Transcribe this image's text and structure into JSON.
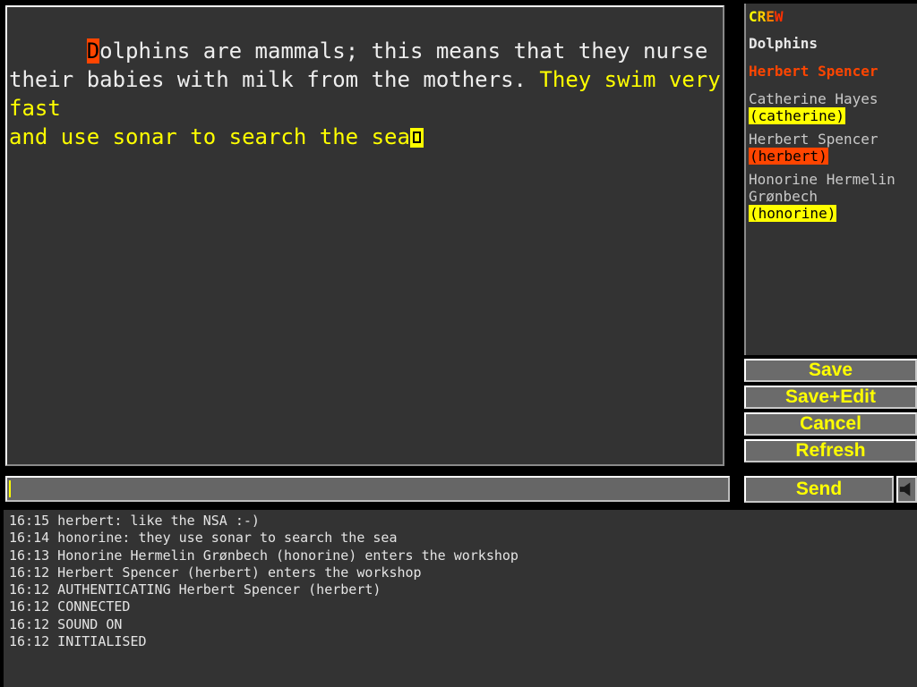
{
  "editor": {
    "segments": [
      {
        "kind": "cursor-char",
        "text": "D"
      },
      {
        "kind": "white",
        "text": "olphins are mammals; this means that they nurse their babies with milk from the "
      },
      {
        "kind": "yellow",
        "text": "They swim very fast\nand use sonar to search the sea"
      },
      {
        "kind": "block-cursor",
        "text": ""
      }
    ],
    "full_text": "Dolphins are mammals; this means that they nurse their babies with milk from the mothers. They swim very fast\nand use sonar to search the sea",
    "line1_white": "olphins are mammals; this means that they nurse their babies with milk from the mothers. ",
    "line1_cursor_char": "D",
    "yellow_run": "They swim very fast",
    "line2_yellow": "and use sonar to search the sea"
  },
  "message_input": {
    "value": "",
    "placeholder": ""
  },
  "crew": {
    "title_letters": [
      "C",
      "R",
      "E",
      "W"
    ],
    "title": "CREW",
    "room": "Dolphins",
    "self_user": "Herbert Spencer",
    "members": [
      {
        "name": "Catherine Hayes",
        "handle": "(catherine)",
        "highlight": "yellow"
      },
      {
        "name": "Herbert Spencer",
        "handle": "(herbert)",
        "highlight": "orange"
      },
      {
        "name": "Honorine Hermelin Grønbech",
        "handle": "(honorine)",
        "highlight": "yellow"
      }
    ]
  },
  "buttons": {
    "save": "Save",
    "save_edit": "Save+Edit",
    "cancel": "Cancel",
    "refresh": "Refresh",
    "send": "Send",
    "sound_icon": "speaker-icon"
  },
  "log": {
    "lines": [
      "16:15 herbert: like the NSA :-)",
      "16:14 honorine: they use sonar to search the sea",
      "16:13 Honorine Hermelin Grønbech (honorine) enters the workshop",
      "16:12 Herbert Spencer (herbert) enters the workshop",
      "16:12 AUTHENTICATING Herbert Spencer (herbert)",
      "16:12 CONNECTED",
      "16:12 SOUND ON",
      "16:12 INITIALISED"
    ]
  },
  "colors": {
    "background": "#000000",
    "panel": "#333333",
    "button_face": "#6b6b6b",
    "accent_yellow": "#ffff00",
    "accent_orange": "#ff4500",
    "text": "#e6e6e6"
  }
}
